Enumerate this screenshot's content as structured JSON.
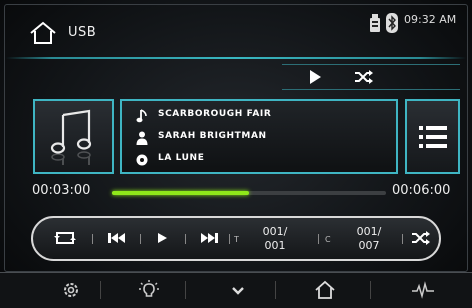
{
  "header": {
    "source": "USB",
    "clock": "09:32 AM",
    "status_icons": [
      "usb-drive-icon",
      "bluetooth-icon"
    ]
  },
  "mini_controls": {
    "icons": [
      "play-icon",
      "shuffle-icon"
    ]
  },
  "track": {
    "title": "SCARBOROUGH FAIR",
    "artist": "SARAH BRIGHTMAN",
    "album": "LA LUNE",
    "icons": [
      "music-note-icon",
      "person-icon",
      "disc-icon"
    ]
  },
  "playback": {
    "current_time": "00:03:00",
    "total_time": "00:06:00",
    "progress": 0.5
  },
  "transport": {
    "track_counter_mark": "T",
    "track_current": "001/",
    "track_total": "001",
    "folder_counter_mark": "C",
    "folder_current": "001/",
    "folder_total": "007",
    "icons": [
      "repeat-icon",
      "previous-icon",
      "play-icon",
      "next-icon",
      "shuffle-icon"
    ]
  },
  "bottom_bar": {
    "icons": [
      "settings-icon",
      "brightness-icon",
      "chevron-down-icon",
      "home-icon",
      "equalizer-icon"
    ]
  },
  "colors": {
    "accent": "#3fb5c3",
    "progress": "#8fe81a"
  }
}
